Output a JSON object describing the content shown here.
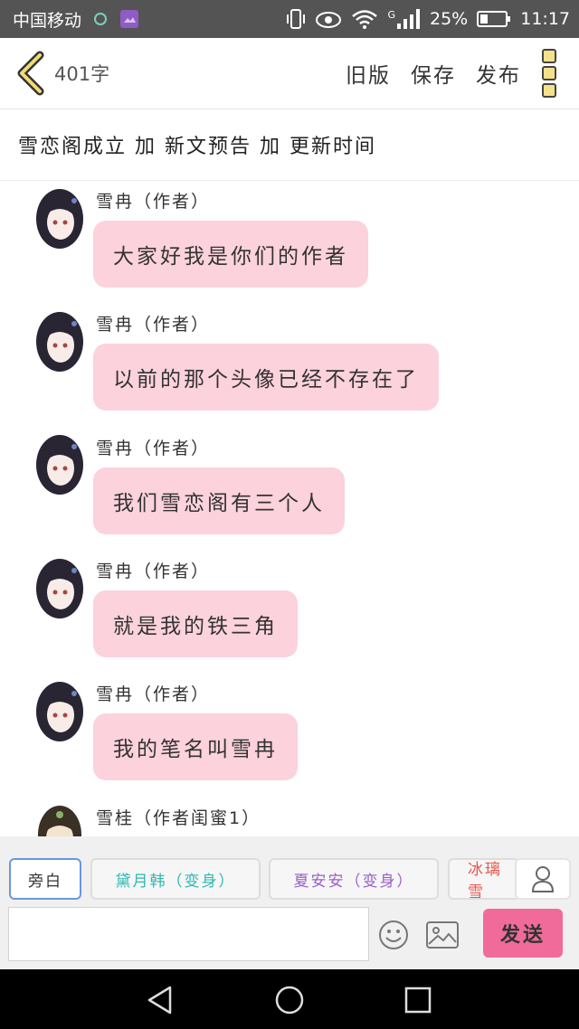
{
  "status_bar": {
    "carrier": "中国移动",
    "signal_label": "G",
    "battery": "25%",
    "time": "11:17"
  },
  "app_bar": {
    "word_count": "401字",
    "actions": [
      "旧版",
      "保存",
      "发布"
    ]
  },
  "title": "雪恋阁成立 加 新文预告 加 更新时间",
  "messages": [
    {
      "sender": "雪冉（作者）",
      "text": "大家好我是你们的作者"
    },
    {
      "sender": "雪冉（作者）",
      "text": "以前的那个头像已经不存在了"
    },
    {
      "sender": "雪冉（作者）",
      "text": "我们雪恋阁有三个人"
    },
    {
      "sender": "雪冉（作者）",
      "text": "就是我的铁三角"
    },
    {
      "sender": "雪冉（作者）",
      "text": "我的笔名叫雪冉"
    },
    {
      "sender": "雪桂（作者闺蜜1）",
      "text": ""
    }
  ],
  "role_chips": [
    "旁白",
    "黛月韩（变身）",
    "夏安安（变身）",
    "冰璃雪"
  ],
  "composer": {
    "input_value": "",
    "send_label": "发送"
  },
  "colors": {
    "status_bar": "#545454",
    "bubble": "#fcd2dc",
    "send_button": "#f06b9a",
    "chip_teal": "#2fb7b0",
    "chip_purple": "#9a60c8",
    "chip_red": "#e8564a"
  }
}
